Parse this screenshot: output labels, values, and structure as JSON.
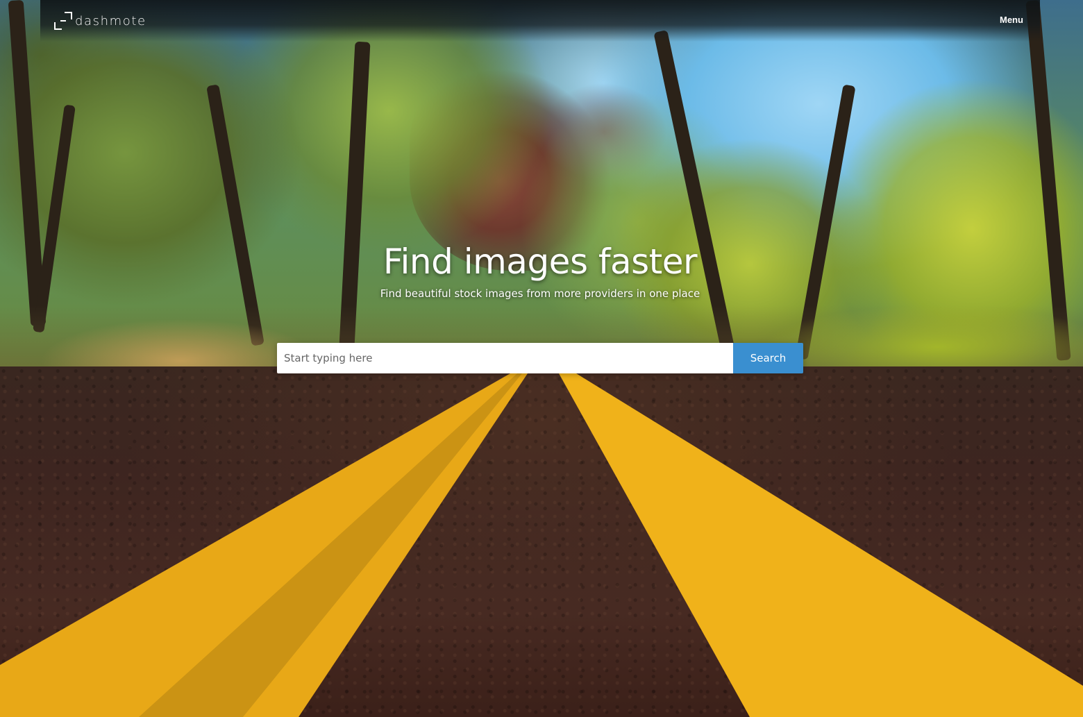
{
  "brand": {
    "name": "dashmote"
  },
  "nav": {
    "menu_label": "Menu"
  },
  "hero": {
    "title": "Find images faster",
    "subtitle": "Find beautiful stock images from more providers in one place"
  },
  "search": {
    "placeholder": "Start typing here",
    "value": "",
    "button_label": "Search"
  },
  "colors": {
    "accent": "#3a8fd0",
    "road_stripe": "#f0b21a",
    "navbar": "#14191c"
  }
}
